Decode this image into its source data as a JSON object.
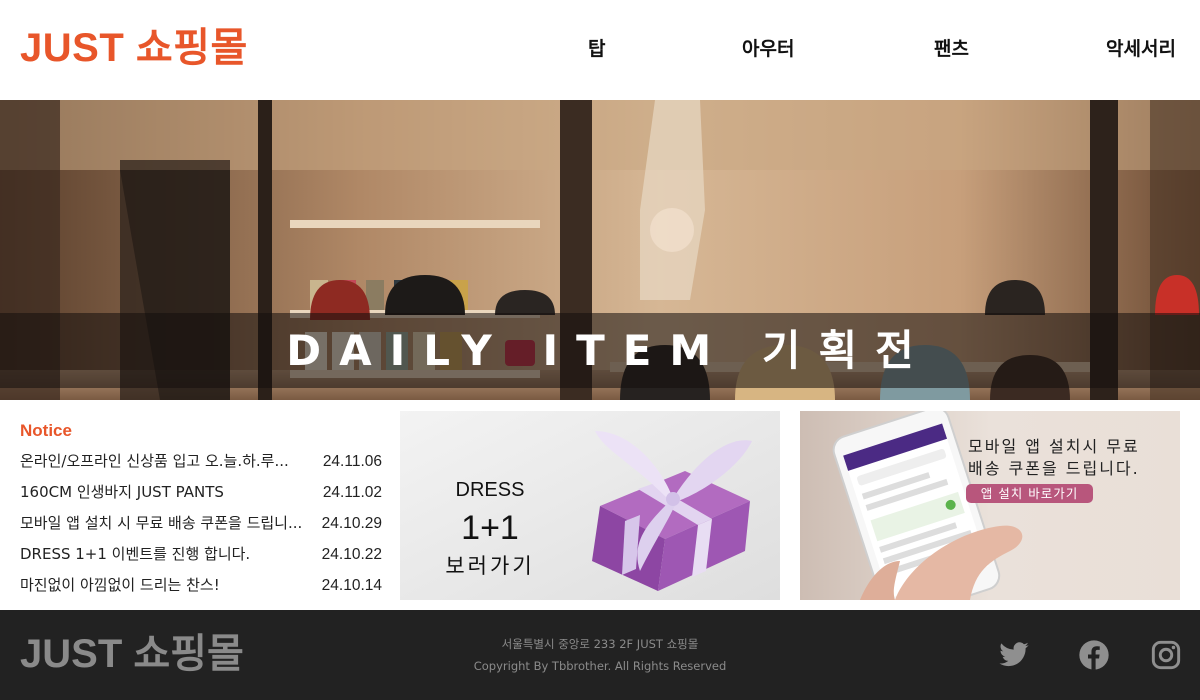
{
  "header": {
    "logo": "JUST 쇼핑몰",
    "nav": [
      "탑",
      "아우터",
      "팬츠",
      "악세서리"
    ]
  },
  "hero": {
    "title": "DAILY ITEM 기획전"
  },
  "notice": {
    "title": "Notice",
    "items": [
      {
        "text": "온라인/오프라인 신상품 입고 오.늘.하.루...",
        "date": "24.11.06"
      },
      {
        "text": "160CM 인생바지 JUST PANTS",
        "date": "24.11.02"
      },
      {
        "text": "모바일 앱 설치 시 무료 배송 쿠폰을 드립니...",
        "date": "24.10.29"
      },
      {
        "text": "DRESS 1+1 이벤트를 진행 합니다.",
        "date": "24.10.22"
      },
      {
        "text": "마진없이 아낌없이 드리는 찬스!",
        "date": "24.10.14"
      }
    ]
  },
  "dress_banner": {
    "label": "DRESS",
    "big": "1+1",
    "cta": "보러가기"
  },
  "app_banner": {
    "line1": "모바일 앱 설치시 무료",
    "line2": "배송 쿠폰을 드립니다.",
    "button": "앱 설치 바로가기"
  },
  "footer": {
    "logo": "JUST 쇼핑몰",
    "address": "서울특별시 중앙로 233 2F  JUST 쇼핑몰",
    "copyright": "Copyright By Tbbrother.  All Rights Reserved",
    "social": [
      "twitter-icon",
      "facebook-icon",
      "instagram-icon"
    ]
  },
  "colors": {
    "brand": "#e8562a",
    "footer_bg": "#222222",
    "app_button": "#b8567c"
  }
}
